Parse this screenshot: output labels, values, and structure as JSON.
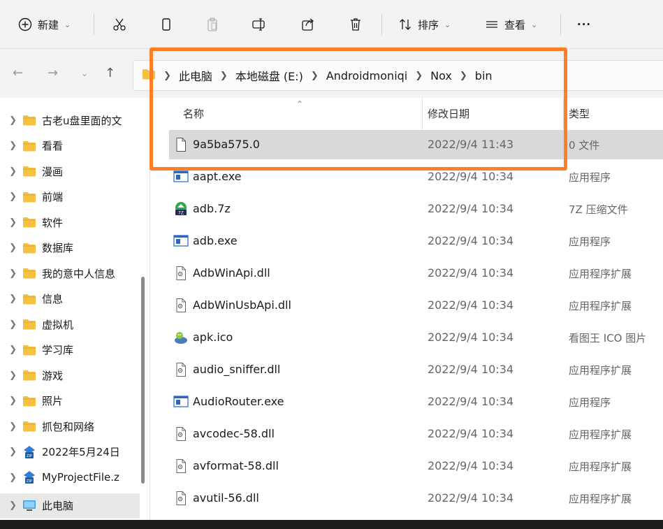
{
  "toolbar": {
    "new_label": "新建",
    "sort_label": "排序",
    "view_label": "查看",
    "more_label": "···"
  },
  "address": {
    "crumbs": [
      "此电脑",
      "本地磁盘 (E:)",
      "Androidmoniqi",
      "Nox",
      "bin"
    ]
  },
  "sidebar": {
    "items": [
      {
        "label": "古老u盘里面的文",
        "icon": "folder-icon"
      },
      {
        "label": "看看",
        "icon": "folder-icon"
      },
      {
        "label": "漫画",
        "icon": "folder-icon"
      },
      {
        "label": "前端",
        "icon": "folder-icon"
      },
      {
        "label": "软件",
        "icon": "folder-icon"
      },
      {
        "label": "数据库",
        "icon": "folder-icon"
      },
      {
        "label": "我的意中人信息",
        "icon": "folder-icon"
      },
      {
        "label": "信息",
        "icon": "folder-icon"
      },
      {
        "label": "虚拟机",
        "icon": "folder-icon"
      },
      {
        "label": "学习库",
        "icon": "folder-icon"
      },
      {
        "label": "游戏",
        "icon": "folder-icon"
      },
      {
        "label": "照片",
        "icon": "folder-icon"
      },
      {
        "label": "抓包和网络",
        "icon": "folder-icon"
      },
      {
        "label": "2022年5月24日",
        "icon": "zip-archive-icon"
      },
      {
        "label": "MyProjectFile.z",
        "icon": "zip-archive-icon"
      },
      {
        "label": "此电脑",
        "icon": "computer-icon"
      }
    ]
  },
  "columns": {
    "name": "名称",
    "date": "修改日期",
    "type": "类型"
  },
  "files": [
    {
      "name": "9a5ba575.0",
      "date": "2022/9/4 11:43",
      "type": "0 文件",
      "icon": "blank-file"
    },
    {
      "name": "aapt.exe",
      "date": "2022/9/4 10:34",
      "type": "应用程序",
      "icon": "exe"
    },
    {
      "name": "adb.7z",
      "date": "2022/9/4 10:34",
      "type": "7Z 压缩文件",
      "icon": "7z"
    },
    {
      "name": "adb.exe",
      "date": "2022/9/4 10:34",
      "type": "应用程序",
      "icon": "exe"
    },
    {
      "name": "AdbWinApi.dll",
      "date": "2022/9/4 10:34",
      "type": "应用程序扩展",
      "icon": "dll"
    },
    {
      "name": "AdbWinUsbApi.dll",
      "date": "2022/9/4 10:34",
      "type": "应用程序扩展",
      "icon": "dll"
    },
    {
      "name": "apk.ico",
      "date": "2022/9/4 10:34",
      "type": "看图王 ICO 图片",
      "icon": "ico"
    },
    {
      "name": "audio_sniffer.dll",
      "date": "2022/9/4 10:34",
      "type": "应用程序扩展",
      "icon": "dll"
    },
    {
      "name": "AudioRouter.exe",
      "date": "2022/9/4 10:34",
      "type": "应用程序",
      "icon": "exe"
    },
    {
      "name": "avcodec-58.dll",
      "date": "2022/9/4 10:34",
      "type": "应用程序扩展",
      "icon": "dll"
    },
    {
      "name": "avformat-58.dll",
      "date": "2022/9/4 10:34",
      "type": "应用程序扩展",
      "icon": "dll"
    },
    {
      "name": "avutil-56.dll",
      "date": "2022/9/4 10:34",
      "type": "应用程序扩展",
      "icon": "dll"
    }
  ],
  "colors": {
    "highlight": "#ff7f27",
    "folder": "#f4c142",
    "selected_row": "#d9d9d9"
  }
}
